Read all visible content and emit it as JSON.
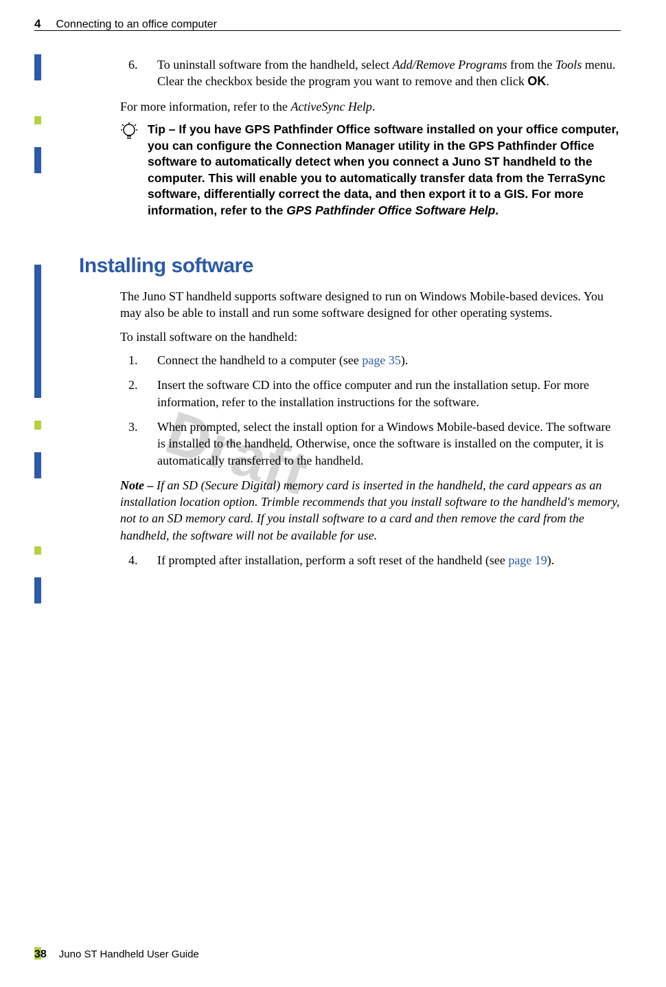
{
  "header": {
    "chapter_number": "4",
    "chapter_title": "Connecting to an office computer"
  },
  "step6": {
    "num": "6.",
    "text_pre": "To uninstall software from the handheld, select ",
    "add_remove": "Add/Remove Programs",
    "text_mid": " from the ",
    "tools": "Tools",
    "text_after1": " menu. Clear the checkbox beside the program you want to remove and then click ",
    "ok": "OK",
    "text_after2": "."
  },
  "more_info": {
    "pre": "For more information, refer to the ",
    "em": "ActiveSync Help",
    "post": "."
  },
  "tip": {
    "lead": "Tip – ",
    "body": "If you have GPS Pathfinder Office software installed on your office computer, you can configure the Connection Manager utility in the GPS Pathfinder Office software to automatically detect when you connect a Juno ST handheld to the computer. This will enable you to automatically transfer data from the TerraSync software, differentially correct the data, and then export it to a GIS. For more information, refer to the ",
    "em": "GPS Pathfinder Office Software Help",
    "post": "."
  },
  "section_heading": "Installing software",
  "intro": "The Juno ST handheld supports software designed to run on Windows Mobile-based devices. You may also be able to install and run some software designed for other operating systems.",
  "to_install": "To install software on the handheld:",
  "step1": {
    "num": "1.",
    "pre": "Connect the handheld to a computer (see ",
    "link": "page 35",
    "post": ")."
  },
  "step2": {
    "num": "2.",
    "text": "Insert the software CD into the office computer and run the installation setup. For more information, refer to the installation instructions for the software."
  },
  "step3": {
    "num": "3.",
    "text": "When prompted, select the install option for a Windows Mobile-based device. The software is installed to the handheld. Otherwise, once the software is installed on the computer, it is automatically transferred to the handheld."
  },
  "note": {
    "lead": "Note – ",
    "body": "If an SD (Secure Digital) memory card is inserted in the handheld, the card appears as an installation location option. Trimble recommends that you install software to the handheld's memory, not to an SD memory card. If you install software to a card and then remove the card from the handheld, the software will not be available for use."
  },
  "step4": {
    "num": "4.",
    "pre": "If prompted after installation, perform a soft reset of the handheld (see ",
    "link": "page 19",
    "post": ")."
  },
  "watermark": "Draft",
  "footer": {
    "page": "38",
    "title": "Juno ST Handheld User Guide"
  }
}
